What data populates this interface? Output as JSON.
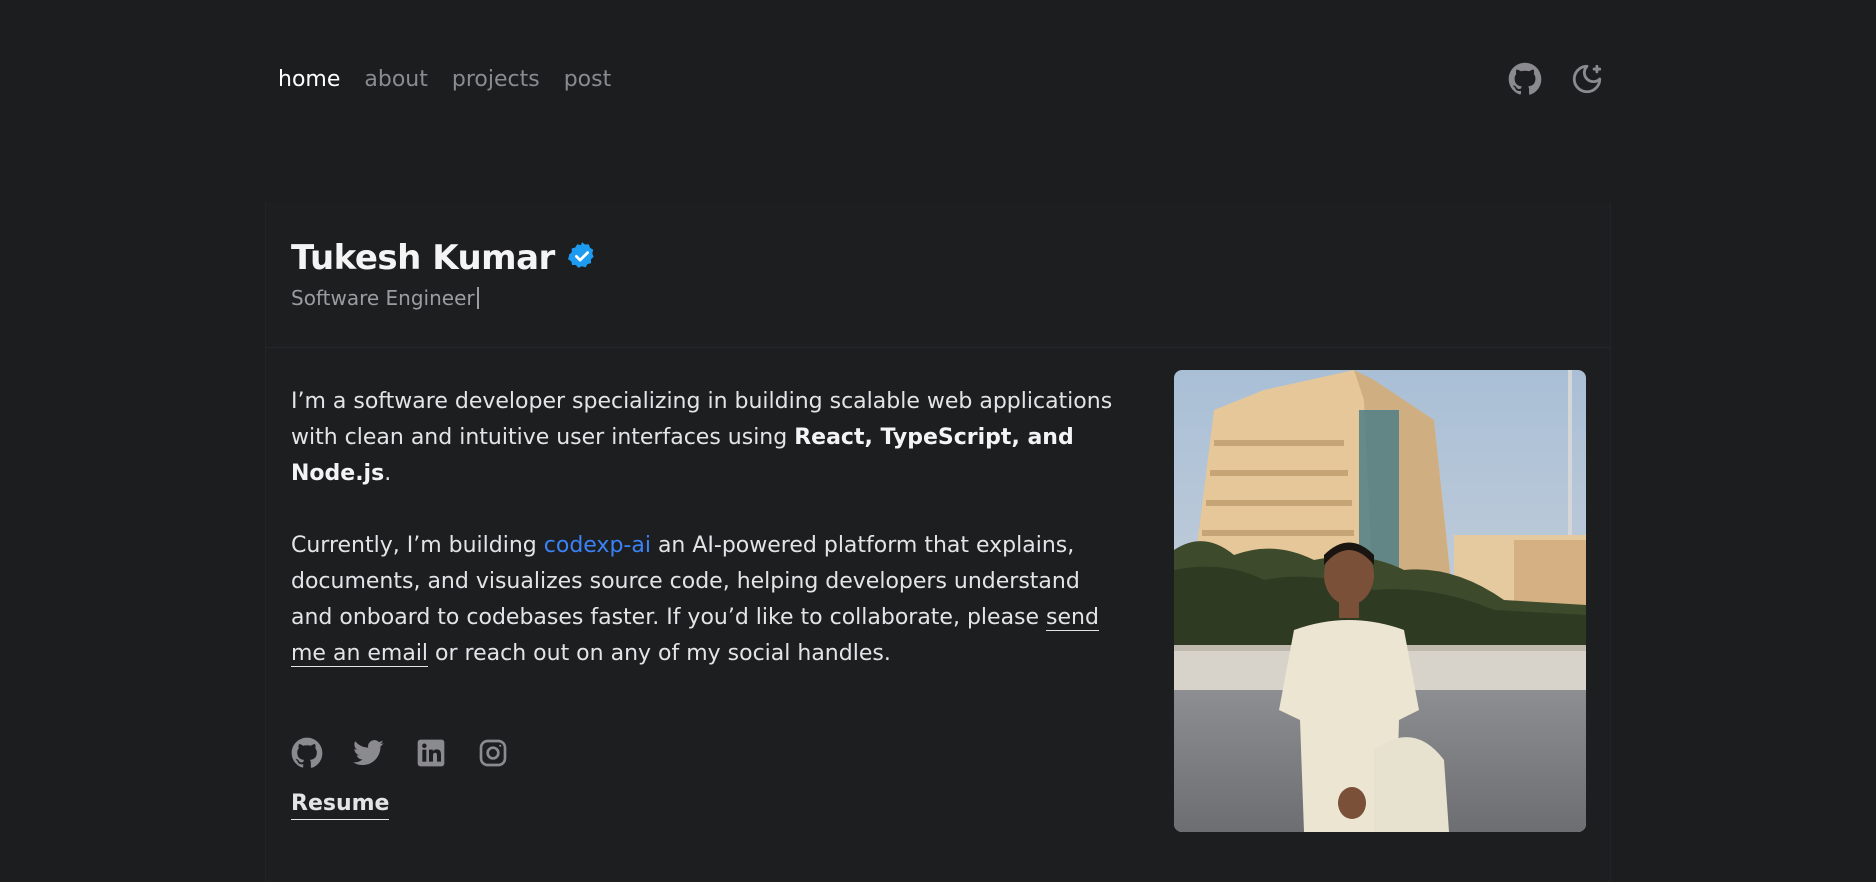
{
  "nav": {
    "items": [
      {
        "label": "home",
        "active": true
      },
      {
        "label": "about",
        "active": false
      },
      {
        "label": "projects",
        "active": false
      },
      {
        "label": "post",
        "active": false
      }
    ],
    "icons": [
      "github-icon",
      "theme-toggle-moon-icon"
    ]
  },
  "profile": {
    "name": "Tukesh Kumar",
    "badge_icon": "verified-badge-icon",
    "subtitle": "Software Engineer"
  },
  "intro": {
    "p1_start": "I’m a software developer specializing in building scalable web applications with clean and intuitive user interfaces using ",
    "p1_bold": "React, TypeScript, and Node.js",
    "p1_end": ".",
    "p2_start": "Currently, I’m building ",
    "p2_link": "codexp-ai",
    "p2_mid": " an AI-powered platform that explains, documents, and visualizes source code, helping developers understand and onboard to codebases faster. If you’d like to collaborate, please ",
    "p2_email_link": "send me an email",
    "p2_end": " or reach out on any of my social handles."
  },
  "socials": [
    "github-icon",
    "twitter-icon",
    "linkedin-icon",
    "instagram-icon"
  ],
  "resume_label": "Resume",
  "colors": {
    "background": "#1c1d1f",
    "link_blue": "#3b82f6",
    "badge_blue": "#1d9bf0",
    "muted": "#8b8b8f"
  }
}
